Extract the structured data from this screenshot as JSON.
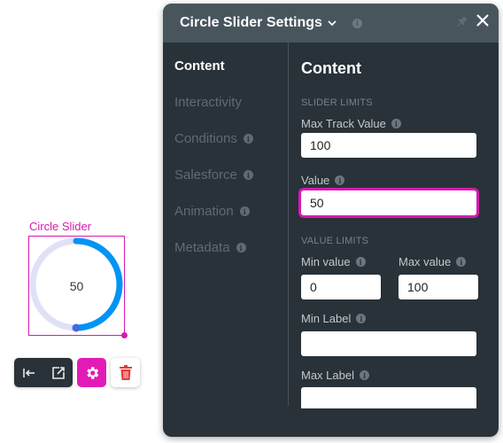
{
  "widget": {
    "label": "Circle Slider",
    "value": "50",
    "fraction": 0.5,
    "track_color": "#dfe1f7",
    "fill_color": "#0094f5",
    "knob_color": "#3d6ce0",
    "selection_color": "#d61ab0"
  },
  "toolbar": {
    "buttons": [
      {
        "icon": "align-left-icon"
      },
      {
        "icon": "open-external-icon"
      },
      {
        "icon": "gear-icon"
      },
      {
        "icon": "trash-icon"
      }
    ]
  },
  "panel": {
    "title": "Circle Slider Settings",
    "nav": [
      {
        "label": "Content",
        "active": true,
        "info": false
      },
      {
        "label": "Interactivity",
        "active": false,
        "info": false
      },
      {
        "label": "Conditions",
        "active": false,
        "info": true
      },
      {
        "label": "Salesforce",
        "active": false,
        "info": true
      },
      {
        "label": "Animation",
        "active": false,
        "info": true
      },
      {
        "label": "Metadata",
        "active": false,
        "info": true
      }
    ],
    "content": {
      "title": "Content",
      "slider_limits": {
        "section_label": "SLIDER LIMITS",
        "max_track_value": {
          "label": "Max Track Value",
          "value": "100"
        },
        "value": {
          "label": "Value",
          "value": "50"
        }
      },
      "value_limits": {
        "section_label": "VALUE LIMITS",
        "min_value": {
          "label": "Min value",
          "value": "0"
        },
        "max_value": {
          "label": "Max value",
          "value": "100"
        },
        "min_label": {
          "label": "Min Label",
          "value": ""
        },
        "max_label": {
          "label": "Max Label",
          "value": ""
        }
      }
    }
  }
}
